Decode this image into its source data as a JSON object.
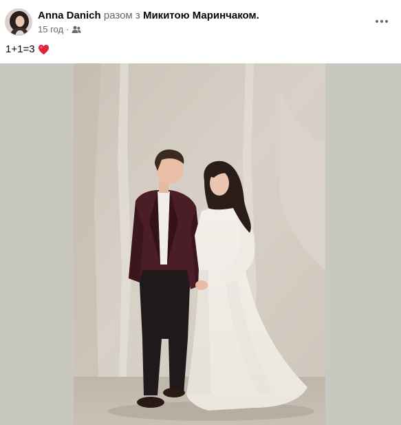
{
  "post": {
    "author": "Anna Danich",
    "with_text": "разом з",
    "tagged": "Микитою Маринчаком.",
    "timestamp": "15 год",
    "separator": "·",
    "audience_icon": "friends-icon",
    "more_icon": "more-horizontal-icon",
    "text": "1+1=3",
    "emoji": "red-heart-icon"
  },
  "colors": {
    "secondary_text": "#65676b",
    "primary_text": "#050505",
    "media_background": "#c8c8c1",
    "heart": "#e0243b"
  }
}
